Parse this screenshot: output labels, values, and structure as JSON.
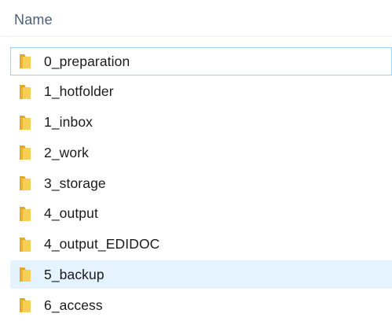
{
  "header": {
    "name_label": "Name"
  },
  "colors": {
    "folder_front": "#f6cf57",
    "folder_back": "#e2a82a",
    "hover_background": "#e5f3ff",
    "focus_border": "#99d1ff",
    "header_text": "#4c607a"
  },
  "files": [
    {
      "name": "0_preparation",
      "icon": "folder-icon",
      "state": "focused"
    },
    {
      "name": "1_hotfolder",
      "icon": "folder-icon",
      "state": "normal"
    },
    {
      "name": "1_inbox",
      "icon": "folder-icon",
      "state": "normal"
    },
    {
      "name": "2_work",
      "icon": "folder-icon",
      "state": "normal"
    },
    {
      "name": "3_storage",
      "icon": "folder-icon",
      "state": "normal"
    },
    {
      "name": "4_output",
      "icon": "folder-icon",
      "state": "normal"
    },
    {
      "name": "4_output_EDIDOC",
      "icon": "folder-icon",
      "state": "normal"
    },
    {
      "name": "5_backup",
      "icon": "folder-icon",
      "state": "hovered"
    },
    {
      "name": "6_access",
      "icon": "folder-icon",
      "state": "normal"
    }
  ]
}
